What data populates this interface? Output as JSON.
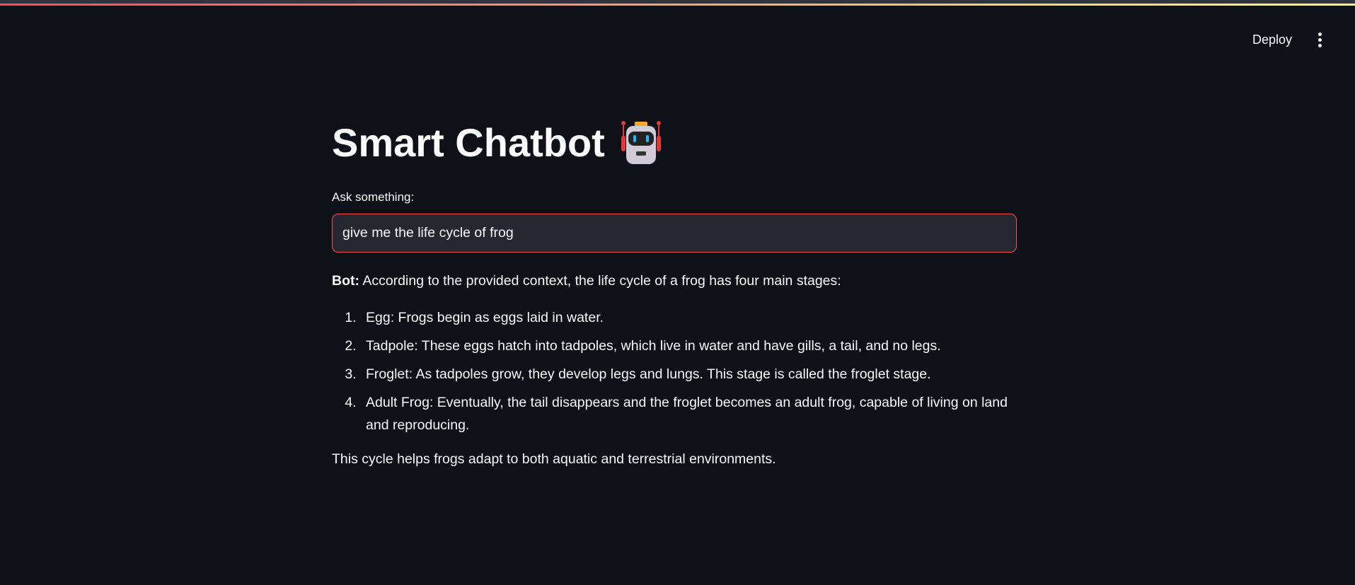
{
  "header": {
    "deploy_label": "Deploy",
    "menu_icon": "vertical-ellipsis-icon"
  },
  "accent": "#ff4b4b",
  "title": "Smart Chatbot",
  "title_icon": "robot-icon",
  "input": {
    "label": "Ask something:",
    "value": "give me the life cycle of frog"
  },
  "answer": {
    "prefix": "Bot:",
    "intro": " According to the provided context, the life cycle of a frog has four main stages:",
    "stages": [
      "Egg: Frogs begin as eggs laid in water.",
      "Tadpole: These eggs hatch into tadpoles, which live in water and have gills, a tail, and no legs.",
      "Froglet: As tadpoles grow, they develop legs and lungs. This stage is called the froglet stage.",
      "Adult Frog: Eventually, the tail disappears and the froglet becomes an adult frog, capable of living on land and reproducing."
    ],
    "conclusion": "This cycle helps frogs adapt to both aquatic and terrestrial environments."
  }
}
